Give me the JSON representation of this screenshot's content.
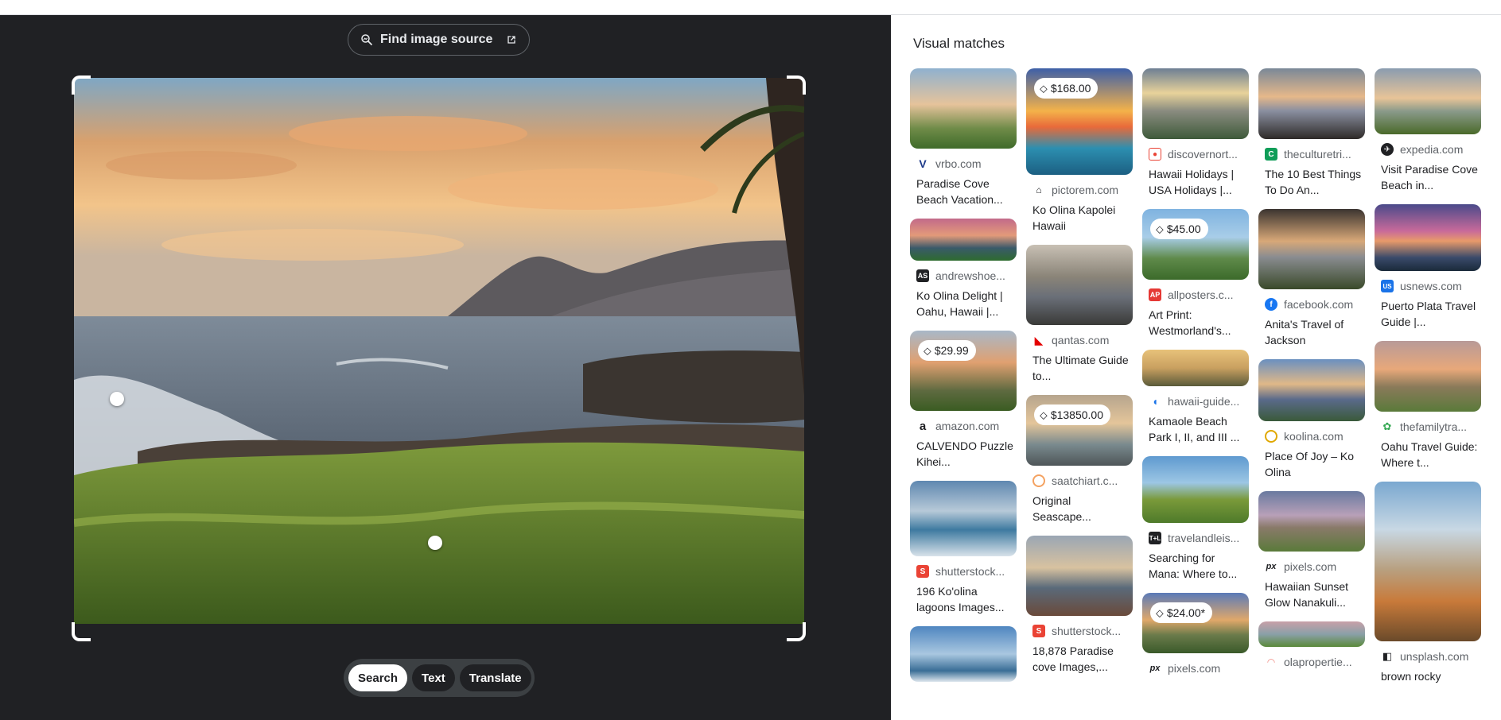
{
  "left_panel": {
    "find_source_label": "Find image source",
    "tabs": [
      {
        "label": "Search",
        "active": true
      },
      {
        "label": "Text",
        "active": false
      },
      {
        "label": "Translate",
        "active": false
      }
    ]
  },
  "visual_matches": {
    "title": "Visual matches",
    "columns": [
      [
        {
          "site": "vrbo.com",
          "title": "Paradise Cove Beach Vacation...",
          "price": "",
          "favicon": "vrbo-icon",
          "fav_color": "#1e3a8a"
        },
        {
          "site": "andrewshoe...",
          "title": "Ko Olina Delight | Oahu, Hawaii |...",
          "price": "",
          "favicon": "andrewshoemaker-icon",
          "fav_color": "#202124"
        },
        {
          "site": "amazon.com",
          "title": "CALVENDO Puzzle Kihei...",
          "price": "$29.99",
          "favicon": "amazon-icon",
          "fav_color": "#ffffff"
        },
        {
          "site": "shutterstock...",
          "title": "196 Ko'olina lagoons Images...",
          "price": "",
          "favicon": "shutterstock-icon",
          "fav_color": "#ea4335"
        },
        {
          "site": "",
          "title": "",
          "price": "",
          "favicon": "",
          "fav_color": "#ffffff"
        }
      ],
      [
        {
          "site": "pictorem.com",
          "title": "Ko Olina Kapolei Hawaii",
          "price": "$168.00",
          "favicon": "pictorem-icon",
          "fav_color": "#202124"
        },
        {
          "site": "qantas.com",
          "title": "The Ultimate Guide to...",
          "price": "",
          "favicon": "qantas-icon",
          "fav_color": "#e40000"
        },
        {
          "site": "saatchiart.c...",
          "title": "Original Seascape...",
          "price": "$13850.00",
          "favicon": "saatchiart-icon",
          "fav_color": "#f4a261"
        },
        {
          "site": "shutterstock...",
          "title": "18,878 Paradise cove Images,...",
          "price": "",
          "favicon": "shutterstock-icon",
          "fav_color": "#ea4335"
        }
      ],
      [
        {
          "site": "discovernort...",
          "title": "Hawaii Holidays | USA Holidays |...",
          "price": "",
          "favicon": "discovernorthamerica-icon",
          "fav_color": "#ea4335"
        },
        {
          "site": "allposters.c...",
          "title": "Art Print: Westmorland's...",
          "price": "$45.00",
          "favicon": "allposters-icon",
          "fav_color": "#e53935"
        },
        {
          "site": "hawaii-guide...",
          "title": "Kamaole Beach Park I, II, and III ...",
          "price": "",
          "favicon": "hawaii-guide-icon",
          "fav_color": "#1a73e8"
        },
        {
          "site": "travelandleis...",
          "title": "Searching for Mana: Where to...",
          "price": "",
          "favicon": "travelandleisure-icon",
          "fav_color": "#202124"
        },
        {
          "site": "pixels.com",
          "title": "",
          "price": "$24.00*",
          "favicon": "pixels-icon",
          "fav_color": "#ffffff"
        }
      ],
      [
        {
          "site": "theculturetri...",
          "title": "The 10 Best Things To Do An...",
          "price": "",
          "favicon": "theculturetrip-icon",
          "fav_color": "#0f9d58"
        },
        {
          "site": "facebook.com",
          "title": "Anita's Travel of Jackson",
          "price": "",
          "favicon": "facebook-icon",
          "fav_color": "#1877f2"
        },
        {
          "site": "koolina.com",
          "title": "Place Of Joy – Ko Olina",
          "price": "",
          "favicon": "koolina-icon",
          "fav_color": "#e0a800"
        },
        {
          "site": "pixels.com",
          "title": "Hawaiian Sunset Glow Nanakuli...",
          "price": "",
          "favicon": "pixels-icon",
          "fav_color": "#ffffff"
        },
        {
          "site": "olapropertie...",
          "title": "",
          "price": "",
          "favicon": "olaproperties-icon",
          "fav_color": "#f28b82"
        }
      ],
      [
        {
          "site": "expedia.com",
          "title": "Visit Paradise Cove Beach in...",
          "price": "",
          "favicon": "expedia-icon",
          "fav_color": "#202124"
        },
        {
          "site": "usnews.com",
          "title": "Puerto Plata Travel Guide |...",
          "price": "",
          "favicon": "usnews-icon",
          "fav_color": "#1a73e8"
        },
        {
          "site": "thefamilytra...",
          "title": "Oahu Travel Guide: Where t...",
          "price": "",
          "favicon": "thefamilytravelers-icon",
          "fav_color": "#34a853"
        },
        {
          "site": "unsplash.com",
          "title": "brown rocky",
          "price": "",
          "favicon": "unsplash-icon",
          "fav_color": "#202124"
        }
      ]
    ]
  },
  "colors": {
    "dark_bg": "#202124",
    "pill_bg": "#3c4043",
    "text": "#202124",
    "muted": "#5f6368"
  }
}
